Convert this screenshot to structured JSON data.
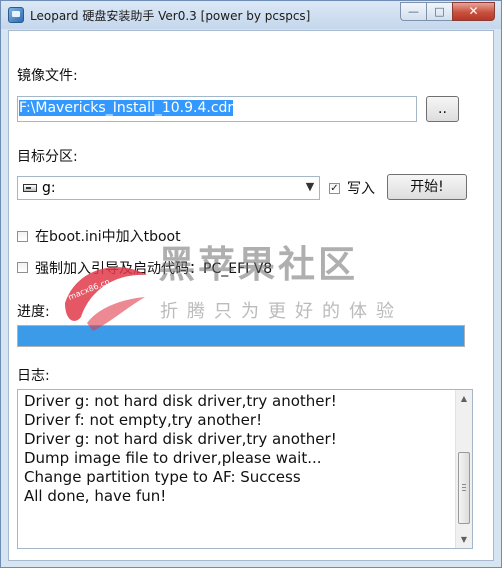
{
  "window": {
    "title": "Leopard 硬盘安装助手 Ver0.3 [power by pcspcs]",
    "minimize_glyph": "—",
    "maximize_glyph": "□",
    "close_glyph": "✕"
  },
  "image_file": {
    "label": "镜像文件:",
    "value": "F:\\Mavericks_Install_10.9.4.cdr",
    "browse_label": ".."
  },
  "target_partition": {
    "label": "目标分区:",
    "selected": "g:",
    "icon": "drive-icon",
    "write_checked": true,
    "write_label": "写入",
    "start_label": "开始!"
  },
  "options": {
    "boot_ini_checked": false,
    "boot_ini_label": "在boot.ini中加入tboot",
    "force_boot_checked": false,
    "force_boot_label": "强制加入引导及启动代码：PC_EFI V8"
  },
  "progress": {
    "label": "进度:",
    "percent": 100,
    "color": "#3c9be8"
  },
  "log": {
    "label": "日志:",
    "lines": [
      "Driver g: not hard disk driver,try another!",
      "Driver f: not empty,try another!",
      "Driver g: not hard disk driver,try another!",
      "Dump image file to driver,please wait...",
      "Change partition type to AF: Success",
      "All done, have fun!"
    ]
  },
  "watermark": {
    "site_name": "黑苹果社区",
    "slogan": "折腾只为更好的体验",
    "url": "macx86.cn",
    "accent": "#e03a4a"
  }
}
